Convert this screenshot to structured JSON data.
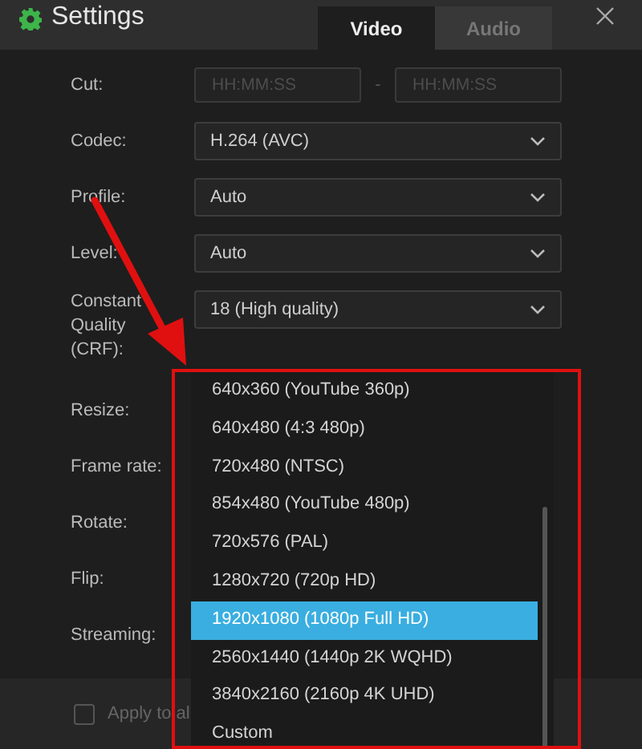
{
  "window": {
    "title": "Settings"
  },
  "tabs": [
    {
      "label": "Video",
      "selected": true
    },
    {
      "label": "Audio",
      "selected": false
    }
  ],
  "fields": [
    {
      "label": "Cut:",
      "kind": "range",
      "placeholders": [
        "HH:MM:SS",
        "HH:MM:SS"
      ],
      "separator": "-"
    },
    {
      "label": "Codec:",
      "kind": "select",
      "value": "H.264 (AVC)"
    },
    {
      "label": "Profile:",
      "kind": "select",
      "value": "Auto"
    },
    {
      "label": "Level:",
      "kind": "select",
      "value": "Auto"
    },
    {
      "label": "Constant Quality (CRF):",
      "kind": "select",
      "value": "18 (High quality)"
    },
    {
      "label": "Resize:",
      "kind": "covered"
    },
    {
      "label": "Frame rate:",
      "kind": "covered"
    },
    {
      "label": "Rotate:",
      "kind": "covered"
    },
    {
      "label": "Flip:",
      "kind": "covered"
    },
    {
      "label": "Streaming:",
      "kind": "covered"
    }
  ],
  "dropdown": {
    "options": [
      {
        "label": "640x360 (YouTube 360p)",
        "selected": false
      },
      {
        "label": "640x480 (4:3 480p)",
        "selected": false
      },
      {
        "label": "720x480 (NTSC)",
        "selected": false
      },
      {
        "label": "854x480 (YouTube 480p)",
        "selected": false
      },
      {
        "label": "720x576 (PAL)",
        "selected": false
      },
      {
        "label": "1280x720 (720p HD)",
        "selected": false
      },
      {
        "label": "1920x1080 (1080p Full HD)",
        "selected": true
      },
      {
        "label": "2560x1440 (1440p 2K WQHD)",
        "selected": false
      },
      {
        "label": "3840x2160 (2160p 4K UHD)",
        "selected": false
      },
      {
        "label": "Custom",
        "selected": false
      }
    ]
  },
  "footer": {
    "checkbox": {
      "label": "Apply to al",
      "checked": false
    }
  }
}
